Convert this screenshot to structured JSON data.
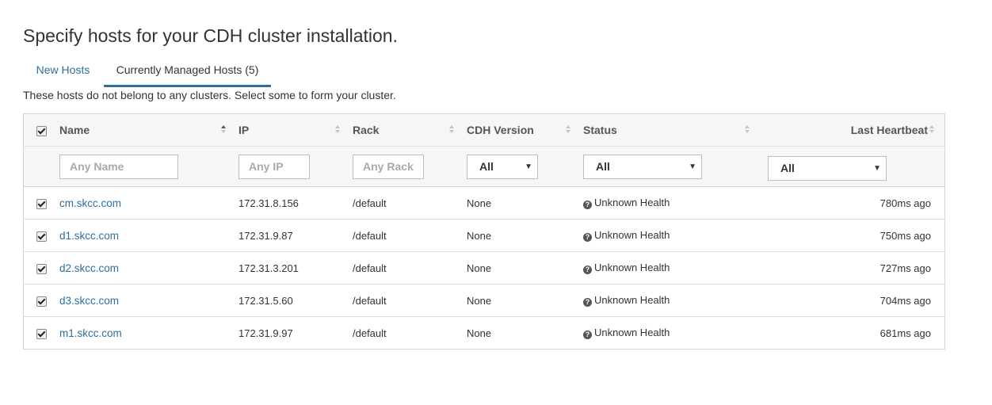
{
  "page": {
    "title": "Specify hosts for your CDH cluster installation.",
    "description": "These hosts do not belong to any clusters. Select some to form your cluster."
  },
  "tabs": [
    {
      "label": "New Hosts",
      "active": false
    },
    {
      "label": "Currently Managed Hosts (5)",
      "active": true
    }
  ],
  "table": {
    "select_all_checked": true,
    "columns": {
      "name": "Name",
      "ip": "IP",
      "rack": "Rack",
      "cdh_version": "CDH Version",
      "status": "Status",
      "last_heartbeat": "Last Heartbeat"
    },
    "sort": {
      "column": "name",
      "direction": "ascending"
    },
    "filters": {
      "name_placeholder": "Any Name",
      "ip_placeholder": "Any IP",
      "rack_placeholder": "Any Rack",
      "cdh_version_value": "All",
      "status_value": "All",
      "last_heartbeat_value": "All"
    },
    "rows": [
      {
        "checked": true,
        "name": "cm.skcc.com",
        "ip": "172.31.8.156",
        "rack": "/default",
        "cdh_version": "None",
        "status": "Unknown Health",
        "last_heartbeat": "780ms ago"
      },
      {
        "checked": true,
        "name": "d1.skcc.com",
        "ip": "172.31.9.87",
        "rack": "/default",
        "cdh_version": "None",
        "status": "Unknown Health",
        "last_heartbeat": "750ms ago"
      },
      {
        "checked": true,
        "name": "d2.skcc.com",
        "ip": "172.31.3.201",
        "rack": "/default",
        "cdh_version": "None",
        "status": "Unknown Health",
        "last_heartbeat": "727ms ago"
      },
      {
        "checked": true,
        "name": "d3.skcc.com",
        "ip": "172.31.5.60",
        "rack": "/default",
        "cdh_version": "None",
        "status": "Unknown Health",
        "last_heartbeat": "704ms ago"
      },
      {
        "checked": true,
        "name": "m1.skcc.com",
        "ip": "172.31.9.97",
        "rack": "/default",
        "cdh_version": "None",
        "status": "Unknown Health",
        "last_heartbeat": "681ms ago"
      }
    ]
  },
  "icons": {
    "status_unknown": "question-circle-icon",
    "sort": "sort-arrows-icon"
  },
  "colors": {
    "link": "#2f6f9f",
    "tab_underline": "#2f6f9f",
    "header_bg": "#f6f6f6"
  }
}
